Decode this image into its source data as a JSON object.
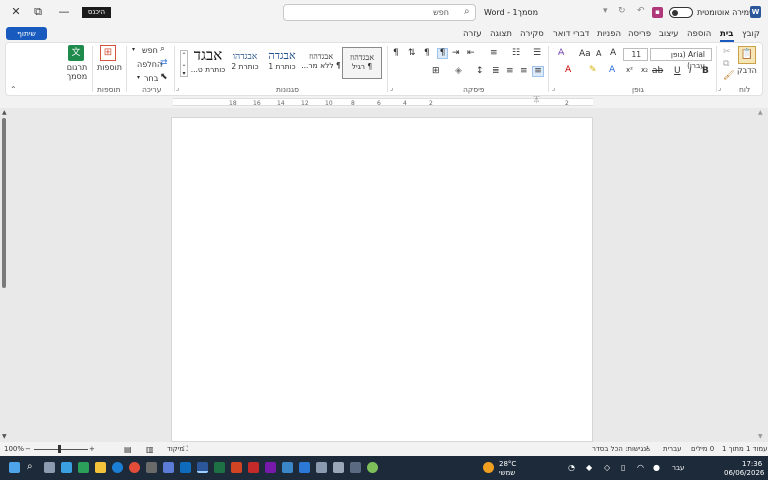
{
  "window": {
    "title": "מסמך1 - Word",
    "search_placeholder": "חפש",
    "sign_in": "היכנס",
    "autosave_label": "שמירה אוטומטית",
    "minimize": "—",
    "maximize": "⧉",
    "close": "✕"
  },
  "tabs": [
    "קובץ",
    "בית",
    "הוספה",
    "עיצוב",
    "פריסה",
    "הפניות",
    "דברי דואר",
    "סקירה",
    "תצוגה",
    "עזרה"
  ],
  "share_label": "שיתוף",
  "ribbon": {
    "groups": {
      "clipboard": "לוח",
      "font": "גופן",
      "paragraph": "פיסקה",
      "styles": "סגנונות",
      "editing": "עריכה",
      "addins": "תוספות"
    },
    "paste_label": "הדבק",
    "font_name": "Arial (גופן עברי)",
    "font_size": "11",
    "styles": [
      {
        "sample": "אבגדהוז",
        "label": "¶ רגיל"
      },
      {
        "sample": "אבגדהוז",
        "label": "¶ ללא מר..."
      },
      {
        "sample": "אבגדה",
        "label": "כותרת 1"
      },
      {
        "sample": "אבגדהו",
        "label": "כותרת 2"
      },
      {
        "sample": "אבגד",
        "label": "כותרת ט..."
      }
    ],
    "find": "חפש",
    "replace": "החלפה",
    "select": "בחר",
    "addins": "תוספות",
    "translate": "תרגום מסמך"
  },
  "ruler_numbers": [
    "18",
    "16",
    "14",
    "12",
    "10",
    "8",
    "6",
    "4",
    "2",
    "2"
  ],
  "status": {
    "page": "עמוד 1 מתוך 1",
    "words": "0 מילים",
    "language": "עברית",
    "accessibility": "נגישות: הכל בסדר",
    "focus": "מיקוד",
    "zoom": "100%"
  },
  "taskbar": {
    "weather_temp": "28°C",
    "weather_desc": "שמשי",
    "lang": "עבר",
    "time": "17:36",
    "date": "06/06/2026"
  }
}
